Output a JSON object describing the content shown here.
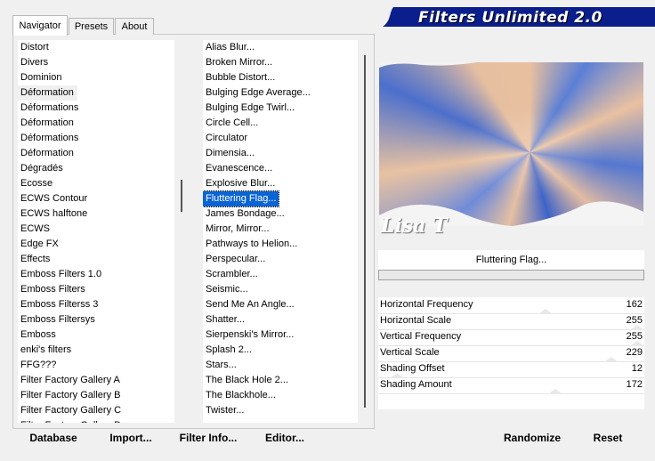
{
  "tabs": [
    {
      "label": "Navigator",
      "active": true
    },
    {
      "label": "Presets",
      "active": false
    },
    {
      "label": "About",
      "active": false
    }
  ],
  "banner": {
    "title": "Filters Unlimited 2.0",
    "color": "#0a1e8c"
  },
  "categories": [
    "Distort",
    "Divers",
    "Dominion",
    "Déformation",
    "Déformations",
    "Déformation",
    "Déformations",
    "Déformation",
    "Dégradés",
    "Ecosse",
    "ECWS Contour",
    "ECWS halftone",
    "ECWS",
    "Edge FX",
    "Effects",
    "Emboss Filters 1.0",
    "Emboss Filters",
    "Emboss Filterss 3",
    "Emboss Filtersys",
    "Emboss",
    "enki's filters",
    "FFG???",
    "Filter Factory Gallery A",
    "Filter Factory Gallery B",
    "Filter Factory Gallery C"
  ],
  "categories_partial": "Filter Factory Gallery D",
  "filters": [
    "Alias Blur...",
    "Broken Mirror...",
    "Bubble Distort...",
    "Bulging Edge Average...",
    "Bulging Edge Twirl...",
    "Circle Cell...",
    "Circulator",
    "Dimensia...",
    "Evanescence...",
    "Explosive Blur...",
    "Fluttering Flag...",
    "James Bondage...",
    "Mirror, Mirror...",
    "Pathways to Helion...",
    "Perspecular...",
    "Scrambler...",
    "Seismic...",
    "Send Me An Angle...",
    "Shatter...",
    "Sierpenski's Mirror...",
    "Splash 2...",
    "Stars...",
    "The Black Hole 2...",
    "The Blackhole...",
    "Twister..."
  ],
  "selected_category_index": 3,
  "selected_filter_index": 10,
  "preview": {
    "signature": "Lisa T"
  },
  "current_filter": "Fluttering Flag...",
  "parameters": [
    {
      "label": "Horizontal Frequency",
      "value": "162"
    },
    {
      "label": "Horizontal Scale",
      "value": "255"
    },
    {
      "label": "Vertical Frequency",
      "value": "255"
    },
    {
      "label": "Vertical Scale",
      "value": "229"
    },
    {
      "label": "Shading Offset",
      "value": "12"
    },
    {
      "label": "Shading Amount",
      "value": "172"
    }
  ],
  "buttons": {
    "database": "Database",
    "import": "Import...",
    "filter_info": "Filter Info...",
    "editor": "Editor...",
    "randomize": "Randomize",
    "reset": "Reset"
  },
  "colors": {
    "selection": "#0a64d4",
    "banner": "#0a1e8c"
  }
}
